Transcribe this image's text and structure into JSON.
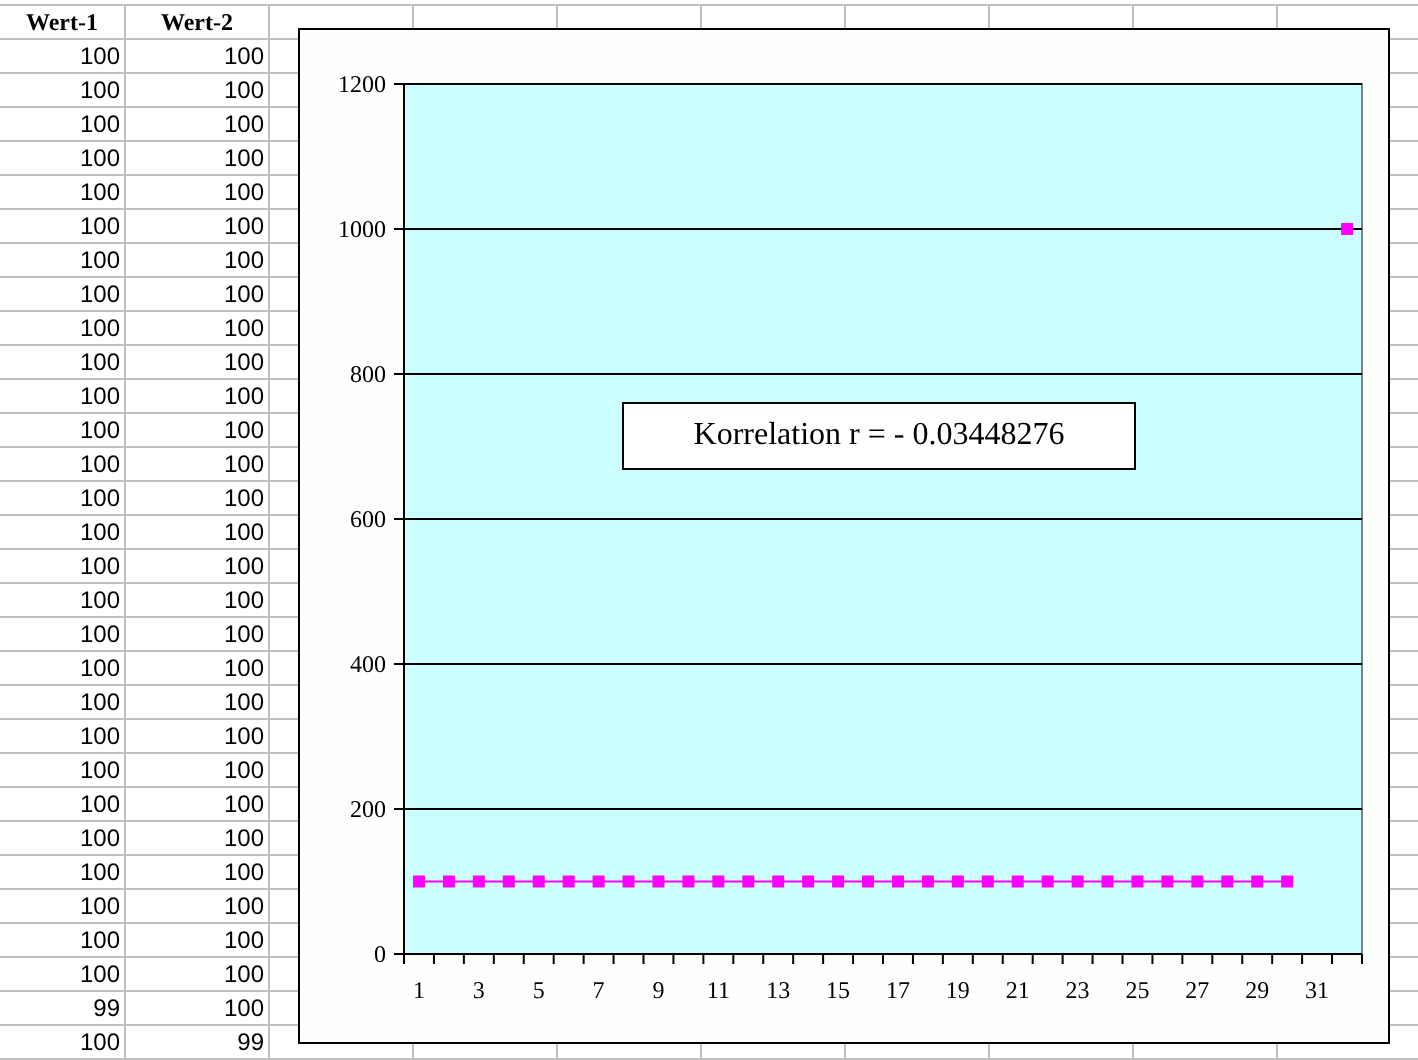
{
  "sheet": {
    "columns": [
      "Wert-1",
      "Wert-2"
    ],
    "rows": [
      [
        "100",
        "100"
      ],
      [
        "100",
        "100"
      ],
      [
        "100",
        "100"
      ],
      [
        "100",
        "100"
      ],
      [
        "100",
        "100"
      ],
      [
        "100",
        "100"
      ],
      [
        "100",
        "100"
      ],
      [
        "100",
        "100"
      ],
      [
        "100",
        "100"
      ],
      [
        "100",
        "100"
      ],
      [
        "100",
        "100"
      ],
      [
        "100",
        "100"
      ],
      [
        "100",
        "100"
      ],
      [
        "100",
        "100"
      ],
      [
        "100",
        "100"
      ],
      [
        "100",
        "100"
      ],
      [
        "100",
        "100"
      ],
      [
        "100",
        "100"
      ],
      [
        "100",
        "100"
      ],
      [
        "100",
        "100"
      ],
      [
        "100",
        "100"
      ],
      [
        "100",
        "100"
      ],
      [
        "100",
        "100"
      ],
      [
        "100",
        "100"
      ],
      [
        "100",
        "100"
      ],
      [
        "100",
        "100"
      ],
      [
        "100",
        "100"
      ],
      [
        "100",
        "100"
      ],
      [
        "99",
        "100"
      ],
      [
        "100",
        "99"
      ]
    ]
  },
  "chart": {
    "annotation": "Korrelation r = - 0.03448276",
    "chart_data": {
      "type": "line",
      "x": [
        1,
        2,
        3,
        4,
        5,
        6,
        7,
        8,
        9,
        10,
        11,
        12,
        13,
        14,
        15,
        16,
        17,
        18,
        19,
        20,
        21,
        22,
        23,
        24,
        25,
        26,
        27,
        28,
        29,
        30,
        31,
        32
      ],
      "series": [
        {
          "color": "#ff00ff",
          "marker": "square",
          "values": [
            100,
            100,
            100,
            100,
            100,
            100,
            100,
            100,
            100,
            100,
            100,
            100,
            100,
            100,
            100,
            100,
            100,
            100,
            100,
            100,
            100,
            100,
            100,
            100,
            100,
            100,
            100,
            100,
            100,
            100,
            null,
            1000
          ]
        }
      ],
      "xlim": [
        0.5,
        32.5
      ],
      "ylim": [
        0,
        1200
      ],
      "grid": "y",
      "yticks": [
        0,
        200,
        400,
        600,
        800,
        1000,
        1200
      ],
      "xticks": [
        1,
        3,
        5,
        7,
        9,
        11,
        13,
        15,
        17,
        19,
        21,
        23,
        25,
        27,
        29,
        31
      ]
    }
  }
}
